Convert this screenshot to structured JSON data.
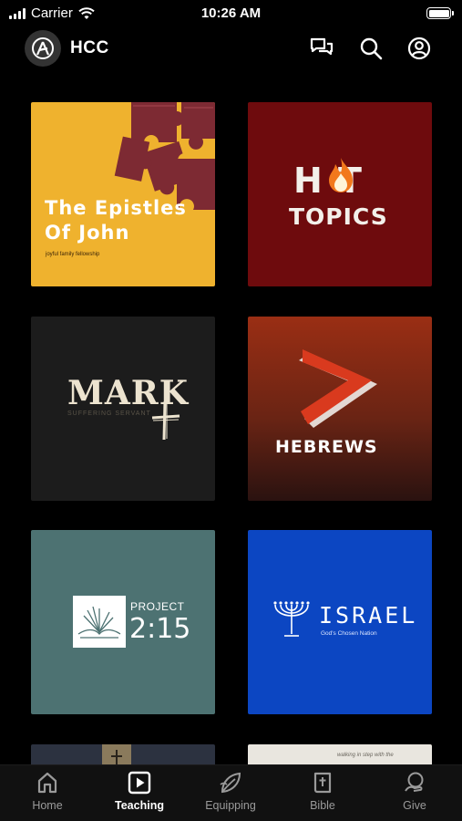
{
  "status_bar": {
    "carrier": "Carrier",
    "time": "10:26 AM"
  },
  "header": {
    "title": "HCC"
  },
  "series": [
    {
      "title_line1": "The Epistles",
      "title_line2": "Of John",
      "subtitle": "joyful family fellowship"
    },
    {
      "title_line1": "H  T",
      "title_line2": "TOPICS"
    },
    {
      "title": "MARK",
      "subtitle": "SUFFERING SERVANT"
    },
    {
      "title": "HEBREWS"
    },
    {
      "title_line1": "PROJECT",
      "title_line2": "2:15"
    },
    {
      "title": "ISRAEL",
      "subtitle": "God's Chosen Nation"
    }
  ],
  "partial_tiles": {
    "right_caption": "walking in step with the"
  },
  "tabs": [
    {
      "label": "Home",
      "icon": "home-icon"
    },
    {
      "label": "Teaching",
      "icon": "play-icon",
      "active": true
    },
    {
      "label": "Equipping",
      "icon": "leaf-icon"
    },
    {
      "label": "Bible",
      "icon": "bible-icon"
    },
    {
      "label": "Give",
      "icon": "give-icon"
    }
  ],
  "colors": {
    "background": "#000000",
    "epistles": "#efb22e",
    "hot_topics": "#6e0b0d",
    "mark": "#1c1c1c",
    "hebrews": "#8a2a14",
    "project215": "#4d7272",
    "israel": "#0c46c2"
  }
}
